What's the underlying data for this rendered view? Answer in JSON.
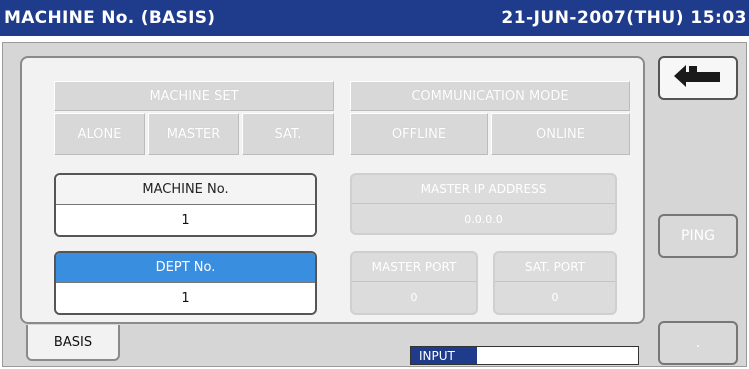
{
  "header": {
    "title": "MACHINE No. (BASIS)",
    "datetime": "21-JUN-2007(THU) 15:03"
  },
  "machine_set": {
    "label": "MACHINE SET",
    "options": [
      "ALONE",
      "MASTER",
      "SAT."
    ]
  },
  "communication_mode": {
    "label": "COMMUNICATION MODE",
    "options": [
      "OFFLINE",
      "ONLINE"
    ]
  },
  "machine_no": {
    "label": "MACHINE No.",
    "value": "1"
  },
  "dept_no": {
    "label": "DEPT No.",
    "value": "1"
  },
  "master_ip": {
    "label": "MASTER IP ADDRESS",
    "value": "0.0.0.0"
  },
  "master_port": {
    "label": "MASTER PORT",
    "value": "0"
  },
  "sat_port": {
    "label": "SAT. PORT",
    "value": "0"
  },
  "side_buttons": {
    "ping": "PING",
    "bottom": "."
  },
  "tab": {
    "label": "BASIS"
  },
  "status": {
    "input_label": "INPUT",
    "input_value": ""
  },
  "colors": {
    "header_bg": "#1f3c8c",
    "selected": "#3a8ee0"
  },
  "icons": {
    "back": "return-arrow-icon"
  }
}
